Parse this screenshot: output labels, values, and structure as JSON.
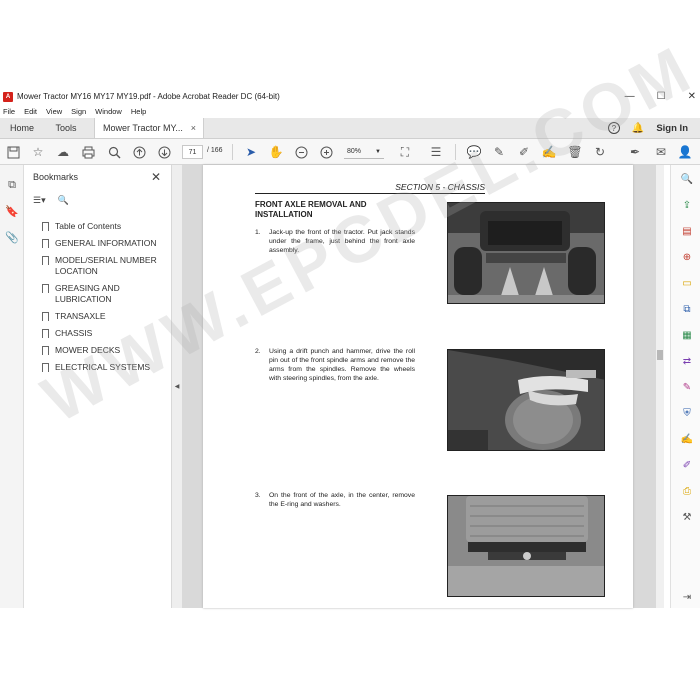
{
  "window": {
    "title": "Mower Tractor MY16 MY17 MY19.pdf - Adobe Acrobat Reader DC (64-bit)",
    "minimize": "—",
    "maximize": "☐",
    "close": "✕"
  },
  "menu": [
    "File",
    "Edit",
    "View",
    "Sign",
    "Window",
    "Help"
  ],
  "tabs": {
    "home": "Home",
    "tools": "Tools",
    "document": "Mower Tractor MY...",
    "close": "×"
  },
  "account": {
    "sign_in": "Sign In",
    "help": "?"
  },
  "toolbar": {
    "current_page": "71",
    "total_pages": "/ 166",
    "zoom": "80%"
  },
  "bookmarks": {
    "title": "Bookmarks",
    "items": [
      "Table of Contents",
      "GENERAL INFORMATION",
      "MODEL/SERIAL NUMBER LOCATION",
      "GREASING AND LUBRICATION",
      "TRANSAXLE",
      "CHASSIS",
      "MOWER DECKS",
      "ELECTRICAL SYSTEMS"
    ]
  },
  "document": {
    "section_header": "SECTION 5 - CHASSIS",
    "procedure_title": "FRONT AXLE REMOVAL AND INSTALLATION",
    "steps": [
      {
        "num": "1.",
        "text": "Jack-up the front of the tractor. Put jack stands under the frame, just behind the front axle assembly."
      },
      {
        "num": "2.",
        "text": "Using a drift punch and hammer, drive the roll pin out of the front spindle arms and remove the arms from the spindles. Remove the wheels with steering spindles, from the axle."
      },
      {
        "num": "3.",
        "text": "On the front of the axle, in the center, remove the E-ring and washers."
      }
    ]
  },
  "watermark": "WWW.EPCDEL.COM",
  "colors": {
    "accent": "#2a5caa",
    "adobe_red": "#d4221b"
  }
}
